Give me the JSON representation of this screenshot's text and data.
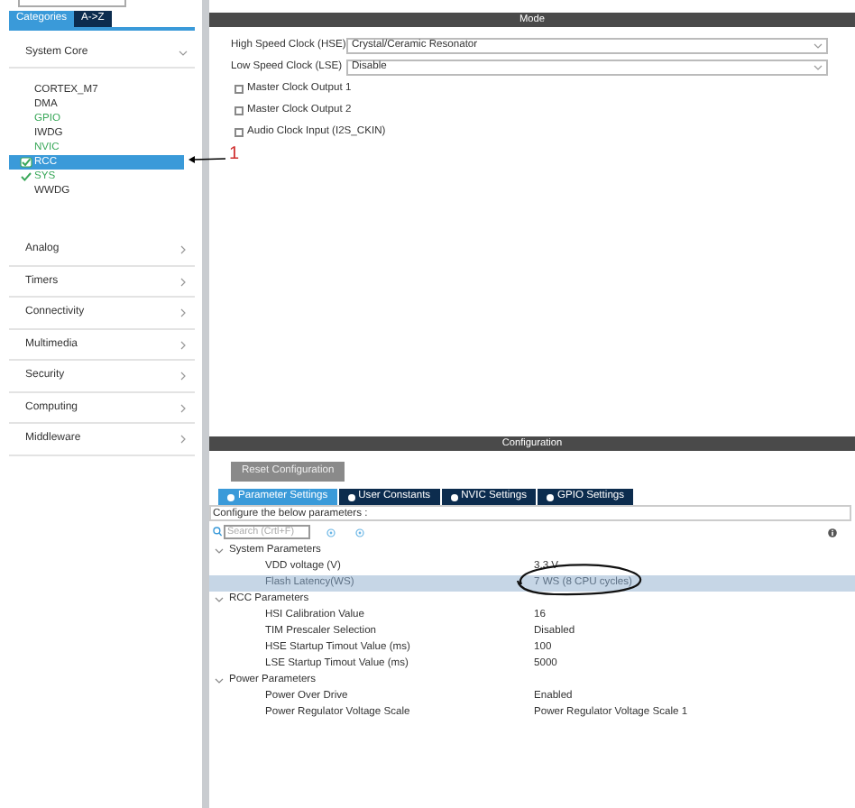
{
  "sidebar": {
    "tabs": [
      {
        "label": "Categories",
        "selected": true
      },
      {
        "label": "A->Z",
        "selected": false
      }
    ],
    "groups": [
      {
        "label": "System Core",
        "expanded": true,
        "items": [
          {
            "label": "CORTEX_M7",
            "enabled": false,
            "checked": false,
            "selected": false
          },
          {
            "label": "DMA",
            "enabled": false,
            "checked": false,
            "selected": false
          },
          {
            "label": "GPIO",
            "enabled": true,
            "checked": false,
            "selected": false
          },
          {
            "label": "IWDG",
            "enabled": false,
            "checked": false,
            "selected": false
          },
          {
            "label": "NVIC",
            "enabled": true,
            "checked": false,
            "selected": false
          },
          {
            "label": "RCC",
            "enabled": true,
            "checked": true,
            "selected": true
          },
          {
            "label": "SYS",
            "enabled": true,
            "checked": true,
            "selected": false
          },
          {
            "label": "WWDG",
            "enabled": false,
            "checked": false,
            "selected": false
          }
        ]
      },
      {
        "label": "Analog",
        "expanded": false
      },
      {
        "label": "Timers",
        "expanded": false
      },
      {
        "label": "Connectivity",
        "expanded": false
      },
      {
        "label": "Multimedia",
        "expanded": false
      },
      {
        "label": "Security",
        "expanded": false
      },
      {
        "label": "Computing",
        "expanded": false
      },
      {
        "label": "Middleware",
        "expanded": false
      }
    ]
  },
  "annotation": {
    "label": "1"
  },
  "mode": {
    "title": "Mode",
    "fields": [
      {
        "label": "High Speed Clock (HSE)",
        "value": "Crystal/Ceramic Resonator"
      },
      {
        "label": "Low Speed Clock (LSE)",
        "value": "Disable"
      }
    ],
    "options": [
      {
        "label": "Master Clock Output 1",
        "checked": false
      },
      {
        "label": "Master Clock Output 2",
        "checked": false
      },
      {
        "label": "Audio Clock Input (I2S_CKIN)",
        "checked": false
      }
    ]
  },
  "configuration": {
    "title": "Configuration",
    "reset_button": "Reset Configuration",
    "tabs": [
      {
        "label": "Parameter Settings",
        "selected": true
      },
      {
        "label": "User Constants",
        "selected": false
      },
      {
        "label": "NVIC Settings",
        "selected": false
      },
      {
        "label": "GPIO Settings",
        "selected": false
      }
    ],
    "hint": "Configure the below parameters :",
    "search": {
      "placeholder": "Search (Crtl+F)"
    },
    "groups": [
      {
        "label": "System Parameters",
        "expanded": true,
        "rows": [
          {
            "name": "VDD voltage (V)",
            "value": "3.3 V",
            "selected": false,
            "disabled": false
          },
          {
            "name": "Flash Latency(WS)",
            "value": "7 WS (8 CPU cycles)",
            "selected": true,
            "disabled": true
          }
        ]
      },
      {
        "label": "RCC Parameters",
        "expanded": true,
        "rows": [
          {
            "name": "HSI Calibration Value",
            "value": "16",
            "selected": false,
            "disabled": false
          },
          {
            "name": "TIM Prescaler Selection",
            "value": "Disabled",
            "selected": false,
            "disabled": false
          },
          {
            "name": "HSE Startup Timout Value (ms)",
            "value": "100",
            "selected": false,
            "disabled": false
          },
          {
            "name": "LSE Startup Timout Value (ms)",
            "value": "5000",
            "selected": false,
            "disabled": false
          }
        ]
      },
      {
        "label": "Power Parameters",
        "expanded": true,
        "rows": [
          {
            "name": "Power Over Drive",
            "value": "Enabled",
            "selected": false,
            "disabled": false
          },
          {
            "name": "Power Regulator Voltage Scale",
            "value": "Power Regulator Voltage Scale 1",
            "selected": false,
            "disabled": false
          }
        ]
      }
    ]
  }
}
